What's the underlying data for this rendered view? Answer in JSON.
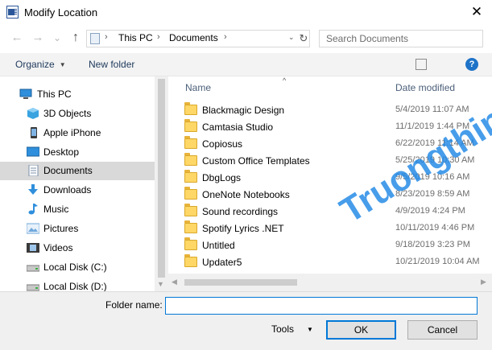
{
  "window": {
    "title": "Modify Location",
    "close_symbol": "✕"
  },
  "nav": {
    "back_symbol": "←",
    "forward_symbol": "→",
    "recent_symbol": "⌄",
    "up_symbol": "↑",
    "breadcrumb": [
      "This PC",
      "Documents"
    ],
    "separator": "›",
    "refresh_symbol": "↻",
    "search_placeholder": "Search Documents"
  },
  "commands": {
    "organize": "Organize",
    "new_folder": "New folder",
    "help_symbol": "?"
  },
  "sidebar": {
    "items": [
      {
        "label": "This PC",
        "icon": "computer-icon",
        "color": "#2f8fdc"
      },
      {
        "label": "3D Objects",
        "icon": "cube-icon",
        "color": "#39a3e0"
      },
      {
        "label": "Apple iPhone",
        "icon": "phone-icon",
        "color": "#4a4a4a"
      },
      {
        "label": "Desktop",
        "icon": "desktop-icon",
        "color": "#2f8fdc"
      },
      {
        "label": "Documents",
        "icon": "document-icon",
        "color": "#7a8fa8",
        "selected": true
      },
      {
        "label": "Downloads",
        "icon": "download-icon",
        "color": "#2f8fdc"
      },
      {
        "label": "Music",
        "icon": "music-icon",
        "color": "#2f8fdc"
      },
      {
        "label": "Pictures",
        "icon": "pictures-icon",
        "color": "#6fa8dc"
      },
      {
        "label": "Videos",
        "icon": "video-icon",
        "color": "#4a4a4a"
      },
      {
        "label": "Local Disk (C:)",
        "icon": "disk-icon",
        "color": "#7a7a7a"
      },
      {
        "label": "Local Disk (D:)",
        "icon": "disk-icon",
        "color": "#7a7a7a"
      }
    ]
  },
  "files": {
    "columns": {
      "name": "Name",
      "date": "Date modified"
    },
    "rows": [
      {
        "name": "Blackmagic Design",
        "date": "5/4/2019 11:07 AM"
      },
      {
        "name": "Camtasia Studio",
        "date": "11/1/2019 1:44 PM"
      },
      {
        "name": "Copiosus",
        "date": "6/22/2019 11:14 AM"
      },
      {
        "name": "Custom Office Templates",
        "date": "5/25/2019 10:30 AM"
      },
      {
        "name": "DbgLogs",
        "date": "9/5/2019 10:16 AM"
      },
      {
        "name": "OneNote Notebooks",
        "date": "8/23/2019 8:59 AM"
      },
      {
        "name": "Sound recordings",
        "date": "4/9/2019 4:24 PM"
      },
      {
        "name": "Spotify Lyrics .NET",
        "date": "10/11/2019 4:46 PM"
      },
      {
        "name": "Untitled",
        "date": "9/18/2019 3:23 PM"
      },
      {
        "name": "Updater5",
        "date": "10/21/2019 10:04 AM"
      }
    ]
  },
  "footer": {
    "folder_name_label": "Folder name:",
    "folder_name_value": "",
    "tools": "Tools",
    "ok": "OK",
    "cancel": "Cancel"
  },
  "watermark": "Truongthinh.top"
}
